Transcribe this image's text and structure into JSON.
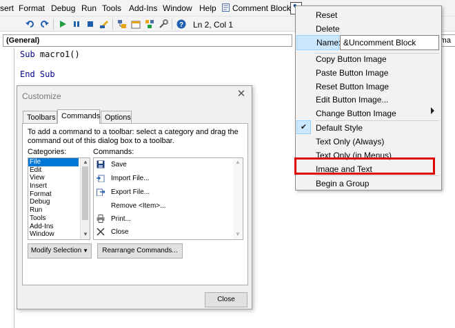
{
  "menubar": {
    "items": [
      "sert",
      "Format",
      "Debug",
      "Run",
      "Tools",
      "Add-Ins",
      "Window",
      "Help",
      "Comment Block"
    ],
    "toolbar_button_icon": "custom-button-image-icon"
  },
  "toolbar": {
    "icons": [
      "undo-icon",
      "redo-icon",
      "run-icon",
      "break-icon",
      "reset-icon",
      "design-mode-icon",
      "project-explorer-icon",
      "properties-icon",
      "object-browser-icon",
      "toolbox-icon",
      "help-icon"
    ],
    "position": "Ln 2, Col 1"
  },
  "code": {
    "general_combo": "(General)",
    "right_combo": "(ma",
    "line1_kw": "Sub",
    "line1_rest": " macro1()",
    "line2": "End Sub"
  },
  "dialog": {
    "title": "Customize",
    "tabs": [
      "Toolbars",
      "Commands",
      "Options"
    ],
    "instruction": "To add a command to a toolbar: select a category and drag the command out of this dialog box to a toolbar.",
    "categories_label": "Categories:",
    "commands_label": "Commands:",
    "categories": [
      "File",
      "Edit",
      "View",
      "Insert",
      "Format",
      "Debug",
      "Run",
      "Tools",
      "Add-Ins",
      "Window"
    ],
    "selected_category": "File",
    "commands": [
      {
        "icon": "save-icon",
        "label": "Save"
      },
      {
        "icon": "import-file-icon",
        "label": "Import File..."
      },
      {
        "icon": "export-file-icon",
        "label": "Export File..."
      },
      {
        "icon": "",
        "label": "Remove <Item>..."
      },
      {
        "icon": "print-icon",
        "label": "Print..."
      },
      {
        "icon": "close-x-icon",
        "label": "Close"
      }
    ],
    "modify_selection": "Modify Selection",
    "rearrange": "Rearrange Commands...",
    "close_btn": "Close"
  },
  "context_menu": {
    "reset": "Reset",
    "delete": "Delete",
    "name_label": "Name:",
    "name_value": "&Uncomment Block",
    "copy_image": "Copy Button Image",
    "paste_image": "Paste Button Image",
    "reset_image": "Reset Button Image",
    "edit_image": "Edit Button Image...",
    "change_image": "Change Button Image",
    "default_style": "Default Style",
    "text_only_always": "Text Only (Always)",
    "text_only_menus": "Text Only (in Menus)",
    "image_and_text": "Image and Text",
    "begin_group": "Begin a Group"
  },
  "colors": {
    "selection": "#0078d7",
    "menu_hover": "#cce8ff",
    "annotation": "#e00000"
  }
}
